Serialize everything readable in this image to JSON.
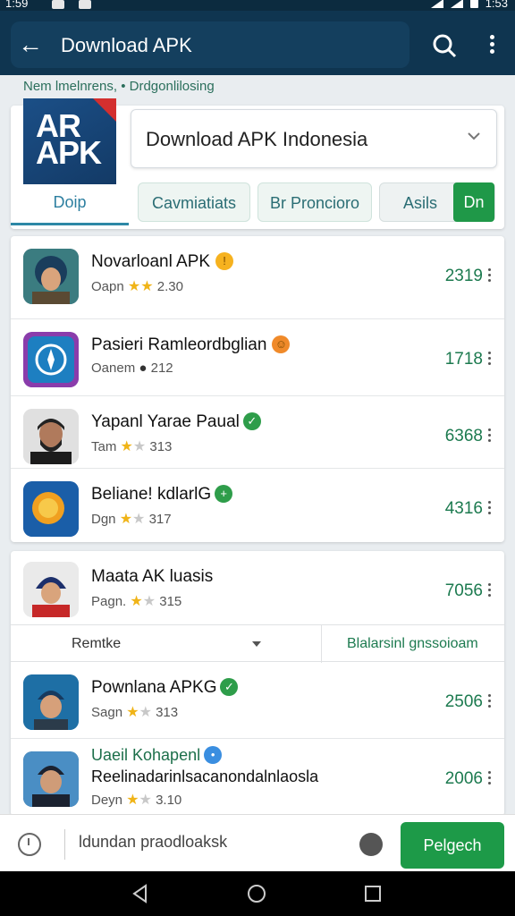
{
  "status": {
    "time": "1:59",
    "clock_right": "1:53"
  },
  "appbar": {
    "title": "Download APK"
  },
  "subheading": "Nem lmelnrens, • Drdgonlilosing",
  "hero": {
    "logo_line1": "AR",
    "logo_line2": "APK",
    "dropdown_value": "Download APK Indonesia",
    "tabs": [
      "Doip",
      "Cavmiatiats",
      "Br Proncioro",
      "Asils",
      "Dn"
    ]
  },
  "list1": [
    {
      "name": "Novarloanl APK",
      "meta_prefix": "Oapn",
      "meta_num": "2.30",
      "count": "2319",
      "icon": "helmet-person-icon"
    },
    {
      "name": "Pasieri Ramleordbglian",
      "meta_prefix": "Oanem",
      "meta_num": "212",
      "count": "1718",
      "icon": "compass-app-icon"
    },
    {
      "name": "Yapanl Yarae Paual",
      "meta_prefix": "Tam",
      "meta_num": "313",
      "count": "6368",
      "icon": "bearded-man-icon"
    },
    {
      "name": "Beliane! kdlarlG",
      "meta_prefix": "Dgn",
      "meta_num": "317",
      "count": "4316",
      "icon": "coin-app-icon"
    }
  ],
  "card2_first": {
    "name": "Maata AK luasis",
    "meta_prefix": "Pagn.",
    "meta_num": "315",
    "count": "7056",
    "icon": "cap-person-icon"
  },
  "filter": {
    "left": "Remtke",
    "right": "Blalarsinl gnssoioam"
  },
  "list2": [
    {
      "name": "Pownlana APKG",
      "meta_prefix": "Sagn",
      "meta_num": "313",
      "count": "2506",
      "icon": "beanie-man-icon"
    },
    {
      "name": "Uaeil Kohapenl",
      "name2": "Reelinadarinlsacanondalnlaosla",
      "meta_prefix": "Deyn",
      "meta_num": "3.10",
      "count": "2006",
      "icon": "cap-man-icon"
    }
  ],
  "bottombar": {
    "input": "ldundan praodloaksk",
    "button": "Pelgech"
  },
  "colors": {
    "appbar": "#0f3550",
    "accent_green": "#1d9a48",
    "count_green": "#1c7a4f"
  }
}
